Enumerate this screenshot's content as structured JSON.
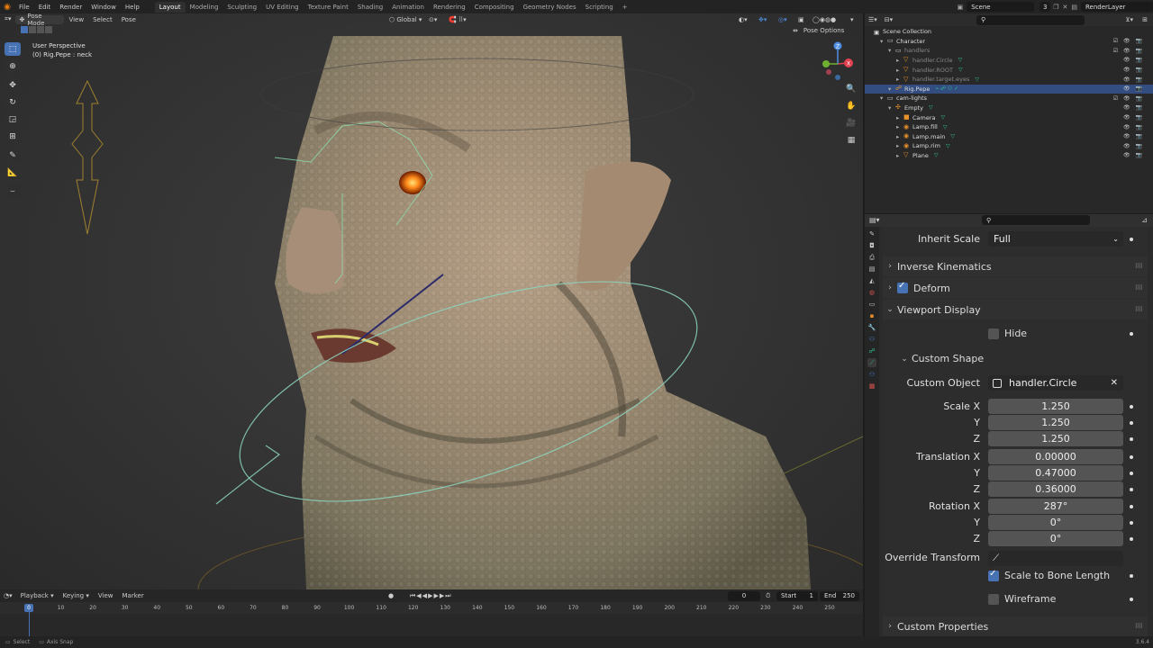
{
  "topbar": {
    "menus": [
      "File",
      "Edit",
      "Render",
      "Window",
      "Help"
    ],
    "workspaces": [
      "Layout",
      "Modeling",
      "Sculpting",
      "UV Editing",
      "Texture Paint",
      "Shading",
      "Animation",
      "Rendering",
      "Compositing",
      "Geometry Nodes",
      "Scripting"
    ],
    "active_workspace": "Layout",
    "add_tab": "+",
    "scene": "Scene",
    "scene_count": "3",
    "view_layer": "RenderLayer"
  },
  "viewport": {
    "mode": "Pose Mode",
    "menus": [
      "View",
      "Select",
      "Pose"
    ],
    "transform_orientation": "Global",
    "pose_options": "Pose Options",
    "info_line1": "User Perspective",
    "info_line2": "(0) Rig.Pepe : neck",
    "gizmo_axes": [
      "X",
      "Y",
      "Z"
    ]
  },
  "outliner": {
    "root": "Scene Collection",
    "rows": [
      {
        "label": "Character",
        "indent": 1,
        "type": "collection"
      },
      {
        "label": "handlers",
        "indent": 2,
        "type": "collection",
        "dim": true
      },
      {
        "label": "handler.Circle",
        "indent": 3,
        "type": "mesh",
        "dim": true
      },
      {
        "label": "handler.ROOT",
        "indent": 3,
        "type": "mesh",
        "dim": true
      },
      {
        "label": "handler.target.eyes",
        "indent": 3,
        "type": "mesh",
        "dim": true
      },
      {
        "label": "Rig.Pepe",
        "indent": 2,
        "type": "armature",
        "selected": true
      },
      {
        "label": "cam-lights",
        "indent": 1,
        "type": "collection"
      },
      {
        "label": "Empty",
        "indent": 2,
        "type": "empty"
      },
      {
        "label": "Camera",
        "indent": 3,
        "type": "camera"
      },
      {
        "label": "Lamp.fill",
        "indent": 3,
        "type": "light"
      },
      {
        "label": "Lamp.main",
        "indent": 3,
        "type": "light"
      },
      {
        "label": "Lamp.rim",
        "indent": 3,
        "type": "light"
      },
      {
        "label": "Plane",
        "indent": 3,
        "type": "mesh"
      }
    ]
  },
  "properties": {
    "inherit_scale_label": "Inherit Scale",
    "inherit_scale_value": "Full",
    "panel_ik": "Inverse Kinematics",
    "panel_deform": "Deform",
    "deform_checked": true,
    "panel_viewport_display": "Viewport Display",
    "hide_label": "Hide",
    "subpanel_custom_shape": "Custom Shape",
    "custom_object_label": "Custom Object",
    "custom_object_value": "handler.Circle",
    "scale_label": "Scale X",
    "scale_x": "1.250",
    "scale_y": "1.250",
    "scale_z": "1.250",
    "translation_label": "Translation X",
    "translation_x": "0.00000",
    "translation_y": "0.47000",
    "translation_z": "0.36000",
    "rotation_label": "Rotation X",
    "rotation_x": "287°",
    "rotation_y": "0°",
    "rotation_z": "0°",
    "axis_y": "Y",
    "axis_z": "Z",
    "override_transform_label": "Override Transform",
    "scale_to_bone_length": "Scale to Bone Length",
    "scale_to_bone_length_checked": true,
    "wireframe": "Wireframe",
    "wireframe_checked": false,
    "panel_custom_properties": "Custom Properties"
  },
  "timeline": {
    "menus": [
      "Playback",
      "Keying",
      "View",
      "Marker"
    ],
    "current_frame": "0",
    "start_label": "Start",
    "start": "1",
    "end_label": "End",
    "end": "250",
    "ruler": [
      "0",
      "10",
      "20",
      "30",
      "40",
      "50",
      "60",
      "70",
      "80",
      "90",
      "100",
      "110",
      "120",
      "130",
      "140",
      "150",
      "160",
      "170",
      "180",
      "190",
      "200",
      "210",
      "220",
      "230",
      "240",
      "250"
    ]
  },
  "statusbar": {
    "left1": "Select",
    "left2": "Axis Snap",
    "version": "3.6.4"
  },
  "colors": {
    "accent": "#4772b3",
    "selection": "#334d80",
    "blender_orange": "#e87d0d",
    "bone_green": "#8ce0b0",
    "eye_orange": "#ff8a1a"
  }
}
